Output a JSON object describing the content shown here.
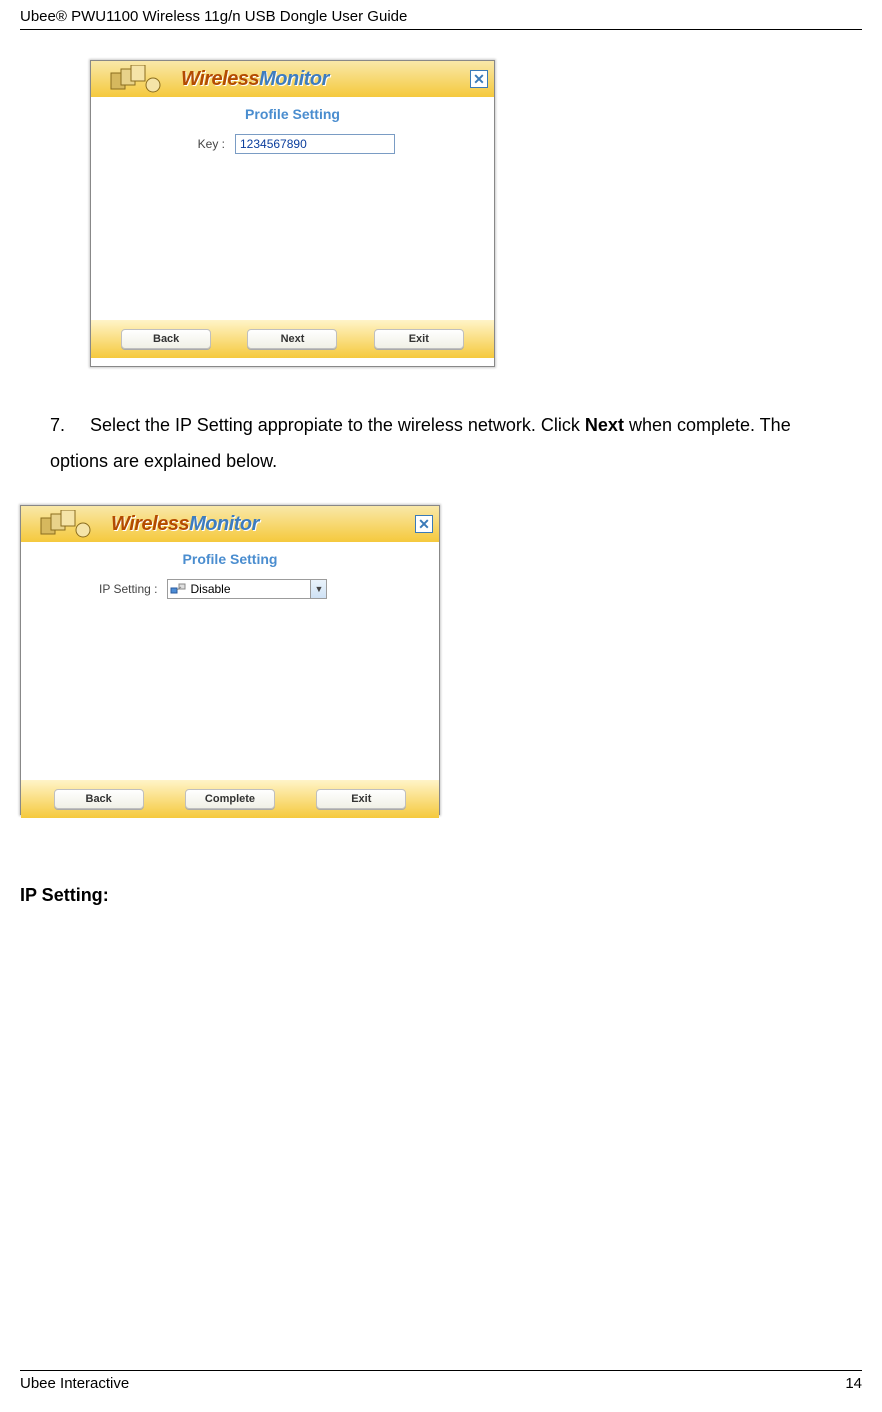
{
  "header": "Ubee® PWU1100 Wireless 11g/n USB Dongle User Guide",
  "footer": {
    "left": "Ubee Interactive",
    "right": "14"
  },
  "screenshot1": {
    "app_title_1": "Wireless",
    "app_title_2": "Monitor",
    "subtitle": "Profile Setting",
    "key_label": "Key :",
    "key_value": "1234567890",
    "buttons": {
      "back": "Back",
      "next": "Next",
      "exit": "Exit"
    },
    "close": "✕"
  },
  "instruction7": {
    "number": "7.",
    "text_part1": "Select the IP Setting appropiate to the wireless network. Click ",
    "text_bold": "Next",
    "text_part2": " when complete. The options are explained below."
  },
  "screenshot2": {
    "app_title_1": "Wireless",
    "app_title_2": "Monitor",
    "subtitle": "Profile Setting",
    "ip_label": "IP Setting :",
    "ip_value": "Disable",
    "buttons": {
      "back": "Back",
      "complete": "Complete",
      "exit": "Exit"
    },
    "close": "✕"
  },
  "section_label": "IP Setting",
  "section_colon": ":"
}
